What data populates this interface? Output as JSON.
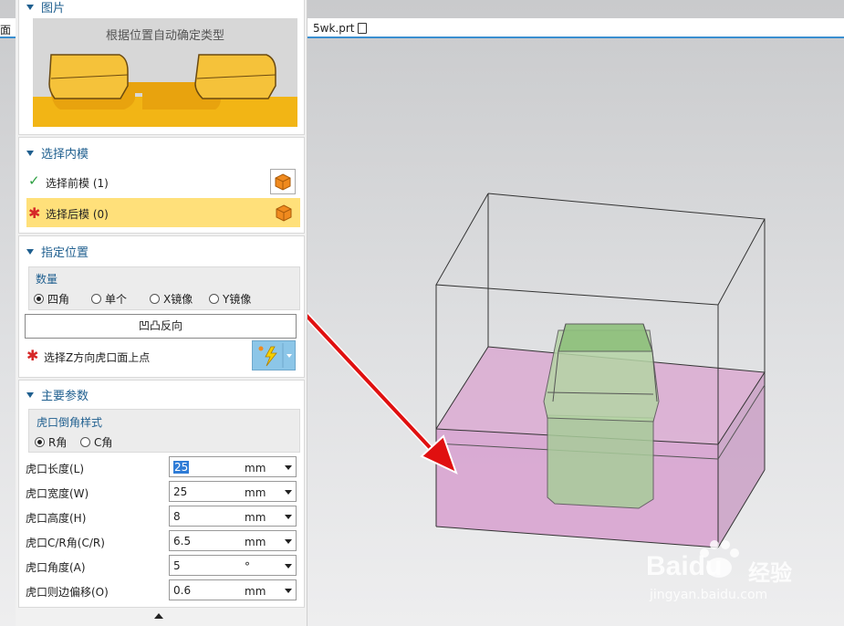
{
  "tab": {
    "file_name": "5wk.prt",
    "left_text": "面"
  },
  "picture": {
    "header": "图片",
    "caption": "根据位置自动确定类型"
  },
  "select_core": {
    "header": "选择内模",
    "front_label": "选择前模 (1)",
    "back_label": "选择后模 (0)"
  },
  "position": {
    "header": "指定位置",
    "group_label": "数量",
    "options": [
      "四角",
      "单个",
      "X镜像",
      "Y镜像"
    ],
    "selected": "四角",
    "flip_button": "凹凸反向",
    "point_label": "选择Z方向虎口面上点"
  },
  "params": {
    "header": "主要参数",
    "style_label": "虎口倒角样式",
    "style_options": [
      "R角",
      "C角"
    ],
    "style_selected": "R角",
    "fields": [
      {
        "label": "虎口长度(L)",
        "value": "25",
        "unit": "mm"
      },
      {
        "label": "虎口宽度(W)",
        "value": "25",
        "unit": "mm"
      },
      {
        "label": "虎口高度(H)",
        "value": "8",
        "unit": "mm"
      },
      {
        "label": "虎口C/R角(C/R)",
        "value": "6.5",
        "unit": "mm"
      },
      {
        "label": "虎口角度(A)",
        "value": "5",
        "unit": "°"
      },
      {
        "label": "虎口则边偏移(O)",
        "value": "0.6",
        "unit": "mm"
      }
    ]
  },
  "watermark": {
    "brand": "Baidu",
    "brand_cn": "经验",
    "url": "jingyan.baidu.com"
  },
  "colors": {
    "accent": "#1f5f8f",
    "highlight": "#ffe07a",
    "pink": "#d9a3cf",
    "green": "#9fc890",
    "arrow": "#e01010",
    "orange": "#f0a020"
  }
}
